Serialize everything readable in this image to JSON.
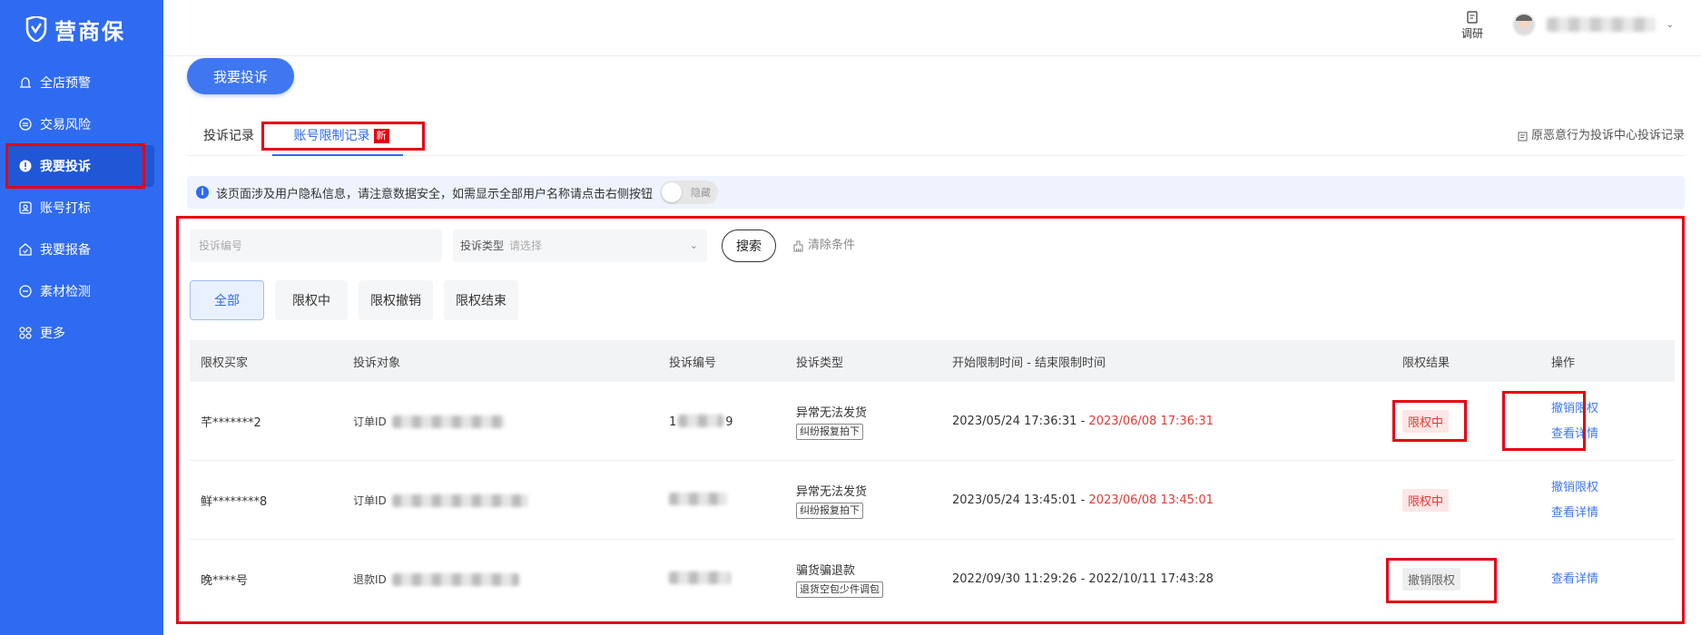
{
  "app": {
    "logo_text": "营商保"
  },
  "sidebar": {
    "items": [
      {
        "label": "全店预警",
        "icon": "alarm-icon"
      },
      {
        "label": "交易风险",
        "icon": "trade-risk-icon"
      },
      {
        "label": "我要投诉",
        "icon": "complaint-icon",
        "active": true
      },
      {
        "label": "账号打标",
        "icon": "account-tag-icon"
      },
      {
        "label": "我要报备",
        "icon": "report-icon"
      },
      {
        "label": "素材检测",
        "icon": "material-check-icon"
      },
      {
        "label": "更多",
        "icon": "more-grid-icon"
      }
    ]
  },
  "topbar": {
    "survey_label": "调研"
  },
  "main": {
    "primary_button": "我要投诉",
    "tabs": [
      {
        "label": "投诉记录"
      },
      {
        "label": "账号限制记录",
        "badge": "新",
        "active": true
      }
    ],
    "tab_right_link": "原恶意行为投诉中心投诉记录",
    "notice": "该页面涉及用户隐私信息，请注意数据安全，如需显示全部用户名称请点击右侧按钮",
    "toggle_label": "隐藏",
    "filters": {
      "complaint_no_placeholder": "投诉编号",
      "type_label": "投诉类型",
      "type_placeholder": "请选择",
      "search_button": "搜索",
      "clear_label": "清除条件"
    },
    "chips": [
      "全部",
      "限权中",
      "限权撤销",
      "限权结束"
    ],
    "table": {
      "headers": [
        "限权买家",
        "投诉对象",
        "投诉编号",
        "投诉类型",
        "开始限制时间 - 结束限制时间",
        "限权结果",
        "操作"
      ],
      "rows": [
        {
          "buyer": "芊*******2",
          "obj_type": "订单ID",
          "complaint_no_prefix": "1",
          "complaint_no_suffix": "9",
          "type_main": "异常无法发货",
          "type_tag": "纠纷报复拍下",
          "time_start": "2023/05/24 17:36:31",
          "time_sep": " - ",
          "time_end": "2023/06/08 17:36:31",
          "result": "限权中",
          "actions": [
            "撤销限权",
            "查看详情"
          ]
        },
        {
          "buyer": "鲜********8",
          "obj_type": "订单ID",
          "type_main": "异常无法发货",
          "type_tag": "纠纷报复拍下",
          "time_start": "2023/05/24 13:45:01",
          "time_sep": " - ",
          "time_end": "2023/06/08 13:45:01",
          "result": "限权中",
          "actions": [
            "撤销限权",
            "查看详情"
          ]
        },
        {
          "buyer": "晚****号",
          "obj_type": "退款ID",
          "type_main": "骗货骗退款",
          "type_tag": "退货空包少件调包",
          "time_start": "2022/09/30 11:29:26",
          "time_sep": " - ",
          "time_end": "2022/10/11 17:43:28",
          "result": "撤销限权",
          "actions": [
            "查看详情"
          ]
        }
      ]
    }
  },
  "colors": {
    "brand": "#2f6bf0",
    "highlight": "#e60012",
    "danger": "#e53935"
  }
}
